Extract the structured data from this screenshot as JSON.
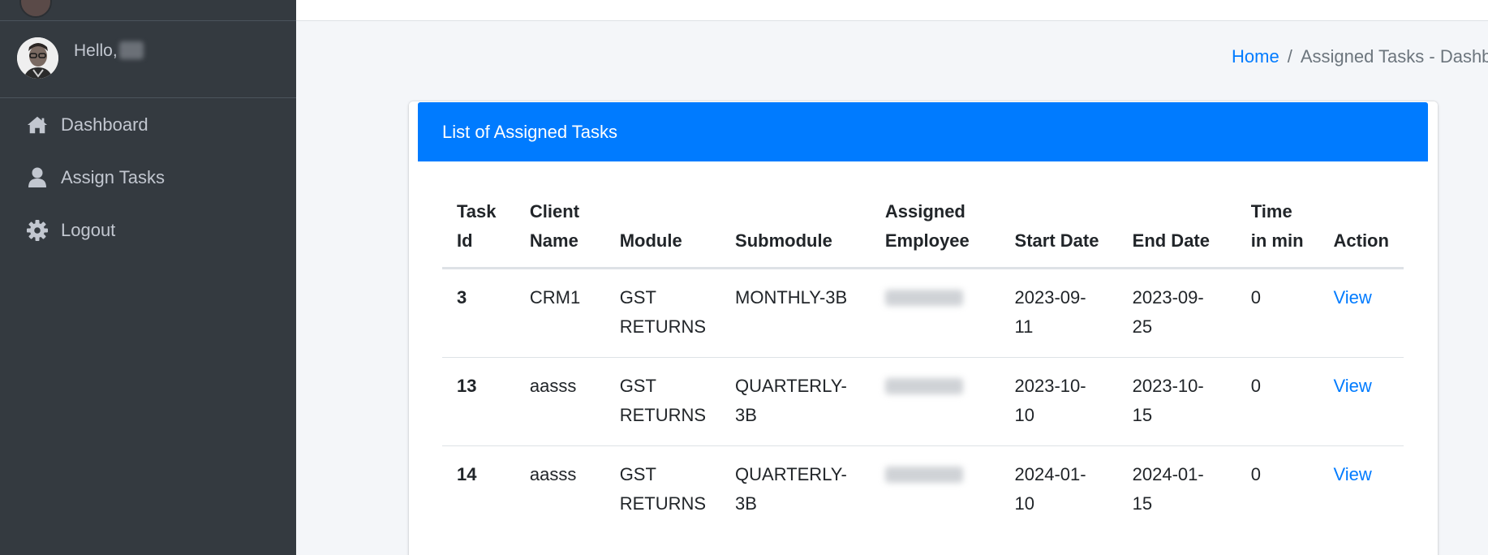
{
  "sidebar": {
    "user": {
      "greeting": "Hello,"
    },
    "items": [
      {
        "label": "Dashboard",
        "icon": "home-icon"
      },
      {
        "label": "Assign Tasks",
        "icon": "user-icon"
      },
      {
        "label": "Logout",
        "icon": "gear-icon"
      }
    ]
  },
  "breadcrumb": {
    "home": "Home",
    "separator": "/",
    "current": "Assigned Tasks - Dashboard"
  },
  "card": {
    "title": "List of Assigned Tasks"
  },
  "table": {
    "headers": {
      "task_id": [
        "Task",
        "Id"
      ],
      "client_name": [
        "Client",
        "Name"
      ],
      "module": "Module",
      "submodule": "Submodule",
      "assigned_employee": [
        "Assigned",
        "Employee"
      ],
      "start_date": "Start Date",
      "end_date": "End Date",
      "time": [
        "Time",
        "in min"
      ],
      "action": "Action"
    },
    "rows": [
      {
        "task_id": "3",
        "client_name": "CRM1",
        "module": [
          "GST",
          "RETURNS"
        ],
        "submodule": "MONTHLY-3B",
        "start_date": "2023-09-11",
        "end_date": "2023-09-25",
        "time": "0",
        "action": "View"
      },
      {
        "task_id": "13",
        "client_name": "aasss",
        "module": [
          "GST",
          "RETURNS"
        ],
        "submodule": "QUARTERLY-3B",
        "start_date": "2023-10-10",
        "end_date": "2023-10-15",
        "time": "0",
        "action": "View"
      },
      {
        "task_id": "14",
        "client_name": "aasss",
        "module": [
          "GST",
          "RETURNS"
        ],
        "submodule": "QUARTERLY-3B",
        "start_date": "2024-01-10",
        "end_date": "2024-01-15",
        "time": "0",
        "action": "View"
      }
    ]
  },
  "colors": {
    "sidebar_bg": "#343a40",
    "sidebar_text": "#c2c7d0",
    "primary": "#007bff",
    "content_bg": "#f4f6f9",
    "muted": "#6c757d"
  }
}
